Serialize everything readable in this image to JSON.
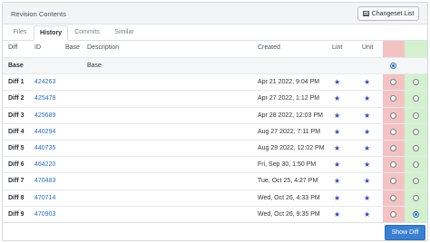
{
  "header": {
    "title": "Revision Contents",
    "changeset_label": "Changeset List"
  },
  "tabs": [
    {
      "label": "Files"
    },
    {
      "label": "History"
    },
    {
      "label": "Commits"
    },
    {
      "label": "Similar"
    }
  ],
  "active_tab": "History",
  "columns": {
    "diff": "Diff",
    "id": "ID",
    "base": "Base",
    "description": "Description",
    "created": "Created",
    "lint": "Lint",
    "unit": "Unit"
  },
  "rows": [
    {
      "diff": "Base",
      "id": "",
      "description": "Base",
      "created": "",
      "lint": "",
      "unit": "",
      "left_selected": true,
      "right_radio": false
    },
    {
      "diff": "Diff 1",
      "id": "424263",
      "description": "",
      "created": "Apr 21 2022, 9:04 PM",
      "lint": "★",
      "unit": "★",
      "left_selected": false,
      "right_radio": true
    },
    {
      "diff": "Diff 2",
      "id": "425478",
      "description": "",
      "created": "Apr 27 2022, 1:12 PM",
      "lint": "★",
      "unit": "★",
      "left_selected": false,
      "right_radio": true
    },
    {
      "diff": "Diff 3",
      "id": "425689",
      "description": "",
      "created": "Apr 28 2022, 12:03 PM",
      "lint": "★",
      "unit": "★",
      "left_selected": false,
      "right_radio": true
    },
    {
      "diff": "Diff 4",
      "id": "440294",
      "description": "",
      "created": "Aug 27 2022, 7:11 PM",
      "lint": "★",
      "unit": "★",
      "left_selected": false,
      "right_radio": true
    },
    {
      "diff": "Diff 5",
      "id": "440735",
      "description": "",
      "created": "Aug 29 2022, 12:02 PM",
      "lint": "★",
      "unit": "★",
      "left_selected": false,
      "right_radio": true
    },
    {
      "diff": "Diff 6",
      "id": "464220",
      "description": "",
      "created": "Fri, Sep 30, 1:50 PM",
      "lint": "★",
      "unit": "★",
      "left_selected": false,
      "right_radio": true
    },
    {
      "diff": "Diff 7",
      "id": "470483",
      "description": "",
      "created": "Tue, Oct 25, 4:27 PM",
      "lint": "★",
      "unit": "★",
      "left_selected": false,
      "right_radio": true
    },
    {
      "diff": "Diff 8",
      "id": "470714",
      "description": "",
      "created": "Wed, Oct 26, 4:33 PM",
      "lint": "★",
      "unit": "★",
      "left_selected": false,
      "right_radio": true
    },
    {
      "diff": "Diff 9",
      "id": "470903",
      "description": "",
      "created": "Wed, Oct 26, 9:35 PM",
      "lint": "★",
      "unit": "★",
      "left_selected": false,
      "right_radio": true,
      "right_selected": true
    }
  ],
  "footer": {
    "show_diff_label": "Show Diff"
  },
  "colors": {
    "accent": "#3b7fcf",
    "left_column": "#f3c3c3",
    "right_column": "#d3f1cf",
    "star": "#3a4aa8"
  }
}
